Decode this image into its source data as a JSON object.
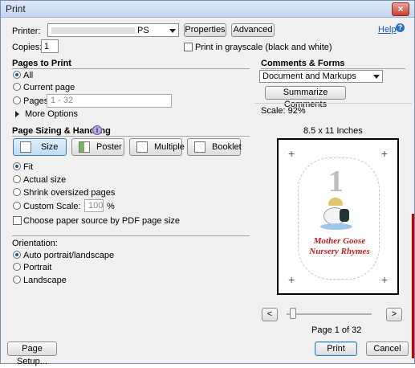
{
  "window": {
    "title": "Print",
    "close_glyph": "×"
  },
  "printer": {
    "label": "Printer:",
    "value_suffix": "PS",
    "properties": "Properties",
    "advanced": "Advanced",
    "help": "Help",
    "copies_label": "Copies:",
    "copies_value": "1",
    "grayscale_label": "Print in grayscale (black and white)"
  },
  "pages": {
    "header": "Pages to Print",
    "all": "All",
    "current": "Current page",
    "pages": "Pages",
    "range": "1 - 32",
    "more": "More Options"
  },
  "sizing": {
    "header": "Page Sizing & Handling",
    "tabs": [
      "Size",
      "Poster",
      "Multiple",
      "Booklet"
    ],
    "fit": "Fit",
    "actual": "Actual size",
    "shrink": "Shrink oversized pages",
    "custom": "Custom Scale:",
    "custom_value": "100",
    "pct": "%",
    "paper_source": "Choose paper source by PDF page size"
  },
  "orientation": {
    "header": "Orientation:",
    "auto": "Auto portrait/landscape",
    "portrait": "Portrait",
    "landscape": "Landscape"
  },
  "comments": {
    "header": "Comments & Forms",
    "select": "Document and Markups",
    "summarize": "Summarize Comments"
  },
  "preview": {
    "scale": "Scale: 92%",
    "paper": "8.5 x 11 Inches",
    "page_label": "Page 1 of 32",
    "number": "1",
    "title_line1": "Mother Goose",
    "title_line2": "Nursery Rhymes",
    "prev": "<",
    "next": ">"
  },
  "footer": {
    "page_setup": "Page Setup...",
    "print": "Print",
    "cancel": "Cancel"
  },
  "colors": {
    "accent": "#1e57a5",
    "title_red": "#c41e1e"
  }
}
